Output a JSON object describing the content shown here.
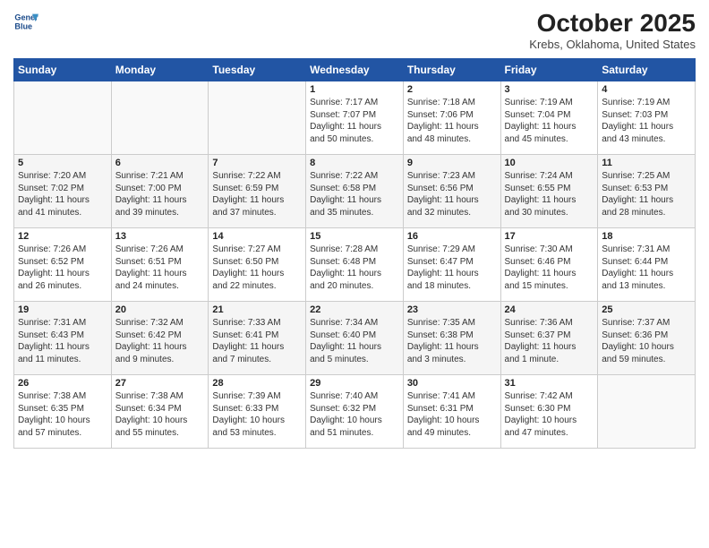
{
  "logo": {
    "line1": "General",
    "line2": "Blue"
  },
  "title": "October 2025",
  "location": "Krebs, Oklahoma, United States",
  "days_header": [
    "Sunday",
    "Monday",
    "Tuesday",
    "Wednesday",
    "Thursday",
    "Friday",
    "Saturday"
  ],
  "weeks": [
    [
      {
        "day": "",
        "text": ""
      },
      {
        "day": "",
        "text": ""
      },
      {
        "day": "",
        "text": ""
      },
      {
        "day": "1",
        "text": "Sunrise: 7:17 AM\nSunset: 7:07 PM\nDaylight: 11 hours\nand 50 minutes."
      },
      {
        "day": "2",
        "text": "Sunrise: 7:18 AM\nSunset: 7:06 PM\nDaylight: 11 hours\nand 48 minutes."
      },
      {
        "day": "3",
        "text": "Sunrise: 7:19 AM\nSunset: 7:04 PM\nDaylight: 11 hours\nand 45 minutes."
      },
      {
        "day": "4",
        "text": "Sunrise: 7:19 AM\nSunset: 7:03 PM\nDaylight: 11 hours\nand 43 minutes."
      }
    ],
    [
      {
        "day": "5",
        "text": "Sunrise: 7:20 AM\nSunset: 7:02 PM\nDaylight: 11 hours\nand 41 minutes."
      },
      {
        "day": "6",
        "text": "Sunrise: 7:21 AM\nSunset: 7:00 PM\nDaylight: 11 hours\nand 39 minutes."
      },
      {
        "day": "7",
        "text": "Sunrise: 7:22 AM\nSunset: 6:59 PM\nDaylight: 11 hours\nand 37 minutes."
      },
      {
        "day": "8",
        "text": "Sunrise: 7:22 AM\nSunset: 6:58 PM\nDaylight: 11 hours\nand 35 minutes."
      },
      {
        "day": "9",
        "text": "Sunrise: 7:23 AM\nSunset: 6:56 PM\nDaylight: 11 hours\nand 32 minutes."
      },
      {
        "day": "10",
        "text": "Sunrise: 7:24 AM\nSunset: 6:55 PM\nDaylight: 11 hours\nand 30 minutes."
      },
      {
        "day": "11",
        "text": "Sunrise: 7:25 AM\nSunset: 6:53 PM\nDaylight: 11 hours\nand 28 minutes."
      }
    ],
    [
      {
        "day": "12",
        "text": "Sunrise: 7:26 AM\nSunset: 6:52 PM\nDaylight: 11 hours\nand 26 minutes."
      },
      {
        "day": "13",
        "text": "Sunrise: 7:26 AM\nSunset: 6:51 PM\nDaylight: 11 hours\nand 24 minutes."
      },
      {
        "day": "14",
        "text": "Sunrise: 7:27 AM\nSunset: 6:50 PM\nDaylight: 11 hours\nand 22 minutes."
      },
      {
        "day": "15",
        "text": "Sunrise: 7:28 AM\nSunset: 6:48 PM\nDaylight: 11 hours\nand 20 minutes."
      },
      {
        "day": "16",
        "text": "Sunrise: 7:29 AM\nSunset: 6:47 PM\nDaylight: 11 hours\nand 18 minutes."
      },
      {
        "day": "17",
        "text": "Sunrise: 7:30 AM\nSunset: 6:46 PM\nDaylight: 11 hours\nand 15 minutes."
      },
      {
        "day": "18",
        "text": "Sunrise: 7:31 AM\nSunset: 6:44 PM\nDaylight: 11 hours\nand 13 minutes."
      }
    ],
    [
      {
        "day": "19",
        "text": "Sunrise: 7:31 AM\nSunset: 6:43 PM\nDaylight: 11 hours\nand 11 minutes."
      },
      {
        "day": "20",
        "text": "Sunrise: 7:32 AM\nSunset: 6:42 PM\nDaylight: 11 hours\nand 9 minutes."
      },
      {
        "day": "21",
        "text": "Sunrise: 7:33 AM\nSunset: 6:41 PM\nDaylight: 11 hours\nand 7 minutes."
      },
      {
        "day": "22",
        "text": "Sunrise: 7:34 AM\nSunset: 6:40 PM\nDaylight: 11 hours\nand 5 minutes."
      },
      {
        "day": "23",
        "text": "Sunrise: 7:35 AM\nSunset: 6:38 PM\nDaylight: 11 hours\nand 3 minutes."
      },
      {
        "day": "24",
        "text": "Sunrise: 7:36 AM\nSunset: 6:37 PM\nDaylight: 11 hours\nand 1 minute."
      },
      {
        "day": "25",
        "text": "Sunrise: 7:37 AM\nSunset: 6:36 PM\nDaylight: 10 hours\nand 59 minutes."
      }
    ],
    [
      {
        "day": "26",
        "text": "Sunrise: 7:38 AM\nSunset: 6:35 PM\nDaylight: 10 hours\nand 57 minutes."
      },
      {
        "day": "27",
        "text": "Sunrise: 7:38 AM\nSunset: 6:34 PM\nDaylight: 10 hours\nand 55 minutes."
      },
      {
        "day": "28",
        "text": "Sunrise: 7:39 AM\nSunset: 6:33 PM\nDaylight: 10 hours\nand 53 minutes."
      },
      {
        "day": "29",
        "text": "Sunrise: 7:40 AM\nSunset: 6:32 PM\nDaylight: 10 hours\nand 51 minutes."
      },
      {
        "day": "30",
        "text": "Sunrise: 7:41 AM\nSunset: 6:31 PM\nDaylight: 10 hours\nand 49 minutes."
      },
      {
        "day": "31",
        "text": "Sunrise: 7:42 AM\nSunset: 6:30 PM\nDaylight: 10 hours\nand 47 minutes."
      },
      {
        "day": "",
        "text": ""
      }
    ]
  ]
}
